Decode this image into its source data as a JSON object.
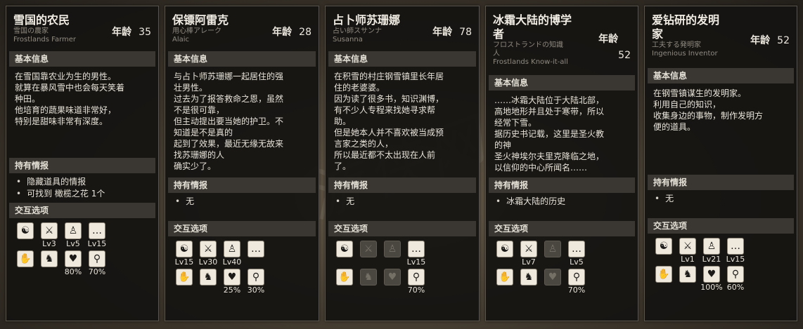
{
  "labels": {
    "age": "年龄",
    "basic_info": "基本信息",
    "intel": "持有情报",
    "interaction": "交互选项"
  },
  "cards": [
    {
      "name": "雪国的农民",
      "jp": "雪国の農家",
      "en": "Frostlands Farmer",
      "age": "35",
      "desc": "在雪国靠农业为生的男性。\n就算在暴风雪中也会每天笑着\n种田。\n他培育的蔬果味道非常好，\n特别是甜味非常有深度。",
      "intel": [
        "隐藏道具的情报",
        "可找到 橄榄之花 1个"
      ],
      "icons": [
        {
          "icon": "stolen-goods-icon",
          "glyph": "☯",
          "label": "",
          "disabled": false
        },
        {
          "icon": "crossed-swords-icon",
          "glyph": "⚔",
          "label": "Lv3",
          "disabled": false
        },
        {
          "icon": "recruit-person-icon",
          "glyph": "♙",
          "label": "Lv5",
          "disabled": false
        },
        {
          "icon": "speech-bubble-icon",
          "glyph": "…",
          "label": "Lv15",
          "disabled": false
        },
        {
          "icon": "hand-icon",
          "glyph": "✋",
          "label": "",
          "disabled": false
        },
        {
          "icon": "beast-icon",
          "glyph": "♞",
          "label": "",
          "disabled": false
        },
        {
          "icon": "heart-icon",
          "glyph": "♥",
          "label": "80%",
          "disabled": false
        },
        {
          "icon": "magnifier-icon",
          "glyph": "⚲",
          "label": "70%",
          "disabled": false
        }
      ]
    },
    {
      "name": "保镖阿雷克",
      "jp": "用心棒アレーク",
      "en": "Alaic",
      "age": "28",
      "desc": "与占卜师苏珊娜一起居住的强\n壮男性。\n过去为了报答救命之恩，虽然\n不是很可靠，\n但主动提出要当她的护卫。不\n知道是不是真的\n起到了效果，最近无缘无故来\n找苏珊娜的人\n确实少了。",
      "intel": [
        "无"
      ],
      "icons": [
        {
          "icon": "stolen-goods-icon",
          "glyph": "☯",
          "label": "Lv15",
          "disabled": false
        },
        {
          "icon": "crossed-swords-icon",
          "glyph": "⚔",
          "label": "Lv30",
          "disabled": false
        },
        {
          "icon": "recruit-person-icon",
          "glyph": "♙",
          "label": "Lv40",
          "disabled": false
        },
        {
          "icon": "speech-bubble-icon",
          "glyph": "…",
          "label": "",
          "disabled": false
        },
        {
          "icon": "hand-icon",
          "glyph": "✋",
          "label": "",
          "disabled": false
        },
        {
          "icon": "beast-icon",
          "glyph": "♞",
          "label": "",
          "disabled": false
        },
        {
          "icon": "heart-icon",
          "glyph": "♥",
          "label": "25%",
          "disabled": false
        },
        {
          "icon": "magnifier-icon",
          "glyph": "⚲",
          "label": "30%",
          "disabled": false
        }
      ]
    },
    {
      "name": "占卜师苏珊娜",
      "jp": "占い師スサンナ",
      "en": "Susanna",
      "age": "78",
      "desc": "在积雪的村庄钢雪镇里长年居\n住的老婆婆。\n因为读了很多书，知识渊博，\n有不少人专程来找她寻求帮\n助。\n但是她本人并不喜欢被当成预\n言家之类的人，\n所以最近都不太出现在人前\n了。",
      "intel": [
        "无"
      ],
      "icons": [
        {
          "icon": "stolen-goods-icon",
          "glyph": "☯",
          "label": "",
          "disabled": false
        },
        {
          "icon": "crossed-swords-icon",
          "glyph": "⚔",
          "label": "",
          "disabled": true
        },
        {
          "icon": "recruit-person-icon",
          "glyph": "♙",
          "label": "",
          "disabled": true
        },
        {
          "icon": "speech-bubble-icon",
          "glyph": "…",
          "label": "Lv15",
          "disabled": false
        },
        {
          "icon": "hand-icon",
          "glyph": "✋",
          "label": "",
          "disabled": false
        },
        {
          "icon": "beast-icon",
          "glyph": "♞",
          "label": "",
          "disabled": true
        },
        {
          "icon": "heart-icon",
          "glyph": "♥",
          "label": "",
          "disabled": true
        },
        {
          "icon": "magnifier-icon",
          "glyph": "⚲",
          "label": "70%",
          "disabled": false
        }
      ]
    },
    {
      "name": "冰霜大陆的博学\n者",
      "jp": "フロストランドの知識\n人",
      "en": "Frostlands Know-it-all",
      "age": "52",
      "desc": "……冰霜大陆位于大陆北部，\n高地地形并且处于寒带，所以\n经常下雪。\n据历史书记载，这里是圣火教\n的神\n圣火神埃尔夫里克降临之地，\n以信仰的中心所闻名……",
      "intel": [
        "冰霜大陆的历史"
      ],
      "icons": [
        {
          "icon": "stolen-goods-icon",
          "glyph": "☯",
          "label": "",
          "disabled": false
        },
        {
          "icon": "crossed-swords-icon",
          "glyph": "⚔",
          "label": "Lv7",
          "disabled": false
        },
        {
          "icon": "recruit-person-icon",
          "glyph": "♙",
          "label": "",
          "disabled": true
        },
        {
          "icon": "speech-bubble-icon",
          "glyph": "…",
          "label": "Lv5",
          "disabled": false
        },
        {
          "icon": "hand-icon",
          "glyph": "✋",
          "label": "",
          "disabled": false
        },
        {
          "icon": "beast-icon",
          "glyph": "♞",
          "label": "",
          "disabled": false
        },
        {
          "icon": "heart-icon",
          "glyph": "♥",
          "label": "",
          "disabled": true
        },
        {
          "icon": "magnifier-icon",
          "glyph": "⚲",
          "label": "70%",
          "disabled": false
        }
      ]
    },
    {
      "name": "爱钻研的发明\n家",
      "jp": "工夫する発明家",
      "en": "Ingenious Inventor",
      "age": "52",
      "desc": "在钢雪镇谋生的发明家。\n利用自己的知识，\n收集身边的事物，制作发明方\n便的道具。",
      "intel": [
        "无"
      ],
      "icons": [
        {
          "icon": "stolen-goods-icon",
          "glyph": "☯",
          "label": "",
          "disabled": false
        },
        {
          "icon": "crossed-swords-icon",
          "glyph": "⚔",
          "label": "Lv1",
          "disabled": false
        },
        {
          "icon": "recruit-person-icon",
          "glyph": "♙",
          "label": "Lv21",
          "disabled": false
        },
        {
          "icon": "speech-bubble-icon",
          "glyph": "…",
          "label": "Lv15",
          "disabled": false
        },
        {
          "icon": "hand-icon",
          "glyph": "✋",
          "label": "",
          "disabled": false
        },
        {
          "icon": "beast-icon",
          "glyph": "♞",
          "label": "",
          "disabled": false
        },
        {
          "icon": "heart-icon",
          "glyph": "♥",
          "label": "100%",
          "disabled": false
        },
        {
          "icon": "magnifier-icon",
          "glyph": "⚲",
          "label": "60%",
          "disabled": false
        }
      ]
    }
  ]
}
